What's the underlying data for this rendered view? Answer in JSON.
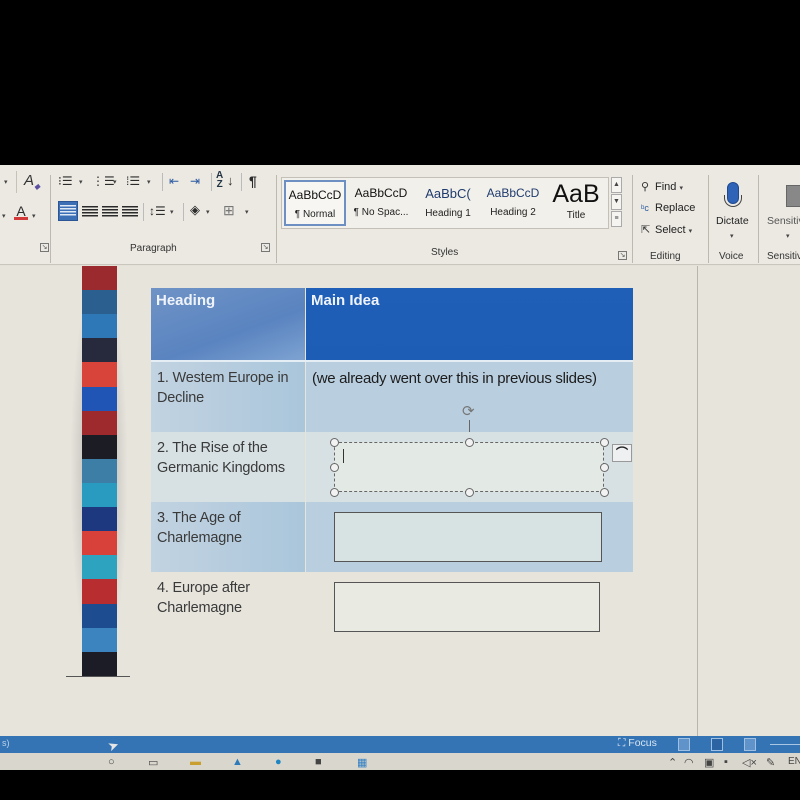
{
  "ribbon": {
    "font_group": {
      "clear_format_icon": "clear-formatting-icon",
      "font_color_icon": "font-color-icon",
      "font_color": "#d23a3a"
    },
    "paragraph": {
      "label": "Paragraph",
      "icons": [
        "bullets-icon",
        "numbering-icon",
        "multilevel-list-icon",
        "decrease-indent-icon",
        "increase-indent-icon",
        "sort-icon",
        "show-marks-icon",
        "align-left-icon",
        "align-center-icon",
        "align-right-icon",
        "justify-icon",
        "line-spacing-icon",
        "shading-icon",
        "borders-icon"
      ],
      "sort_glyph": "A↓Z",
      "pilcrow": "¶",
      "active_alignment": "left"
    },
    "styles": {
      "label": "Styles",
      "items": [
        {
          "preview": "AaBbCcD",
          "name": "¶ Normal",
          "selected": true
        },
        {
          "preview": "AaBbCcD",
          "name": "¶ No Spac...",
          "selected": false
        },
        {
          "preview": "AaBbC(",
          "name": "Heading 1",
          "selected": false
        },
        {
          "preview": "AaBbCcD",
          "name": "Heading 2",
          "selected": false
        },
        {
          "preview": "AaB",
          "name": "Title",
          "selected": false
        }
      ]
    },
    "editing": {
      "label": "Editing",
      "find": "Find",
      "replace": "Replace",
      "select": "Select"
    },
    "voice": {
      "label": "Voice",
      "dictate": "Dictate"
    },
    "sensitivity": {
      "label": "Sensitivity",
      "button": "Sensitivity"
    }
  },
  "document": {
    "table": {
      "headers": [
        "Heading",
        "Main Idea"
      ],
      "rows": [
        {
          "heading": "1. Western Europe in Decline",
          "heading_lines": [
            "1. Westem Europe in",
            "Decline"
          ],
          "main_idea": "(we already went over this in previous slides)"
        },
        {
          "heading": "2. The Rise of the Germanic Kingdoms",
          "heading_lines": [
            "2. The Rise of the",
            "Germanic Kingdoms"
          ],
          "main_idea": ""
        },
        {
          "heading": "3. The Age of Charlemagne",
          "heading_lines": [
            "3. The Age of",
            "Charlemagne"
          ],
          "main_idea": ""
        },
        {
          "heading": "4. Europe after Charlemagne",
          "heading_lines": [
            "4. Europe after",
            "Charlemagne"
          ],
          "main_idea": ""
        }
      ]
    },
    "stripe_colors": [
      "#9b2a2e",
      "#2a5f8f",
      "#2f78b8",
      "#262a3c",
      "#d9443a",
      "#2054b5",
      "#9e2a2e",
      "#1c1d24",
      "#3d7ea6",
      "#2a9bc0",
      "#1e3880",
      "#d8403a",
      "#2ea3bf",
      "#b82d30",
      "#1d4d90",
      "#3c84c0",
      "#1b1c25"
    ],
    "layout_options_icon": "layout-options-icon",
    "rotate_icon": "rotate-handle-icon"
  },
  "statusbar": {
    "left_text": "s)",
    "focus": "Focus",
    "views": [
      "read-mode-icon",
      "print-layout-icon",
      "web-layout-icon"
    ]
  },
  "taskbar": {
    "icons": [
      "search-icon",
      "task-view-icon",
      "file-explorer-icon",
      "mail-icon",
      "edge-icon",
      "store-icon",
      "word-icon"
    ],
    "tray_icons": [
      "chevron-up-icon",
      "network-icon",
      "display-icon",
      "battery-icon",
      "volume-icon",
      "pen-icon"
    ],
    "language": "EN"
  }
}
